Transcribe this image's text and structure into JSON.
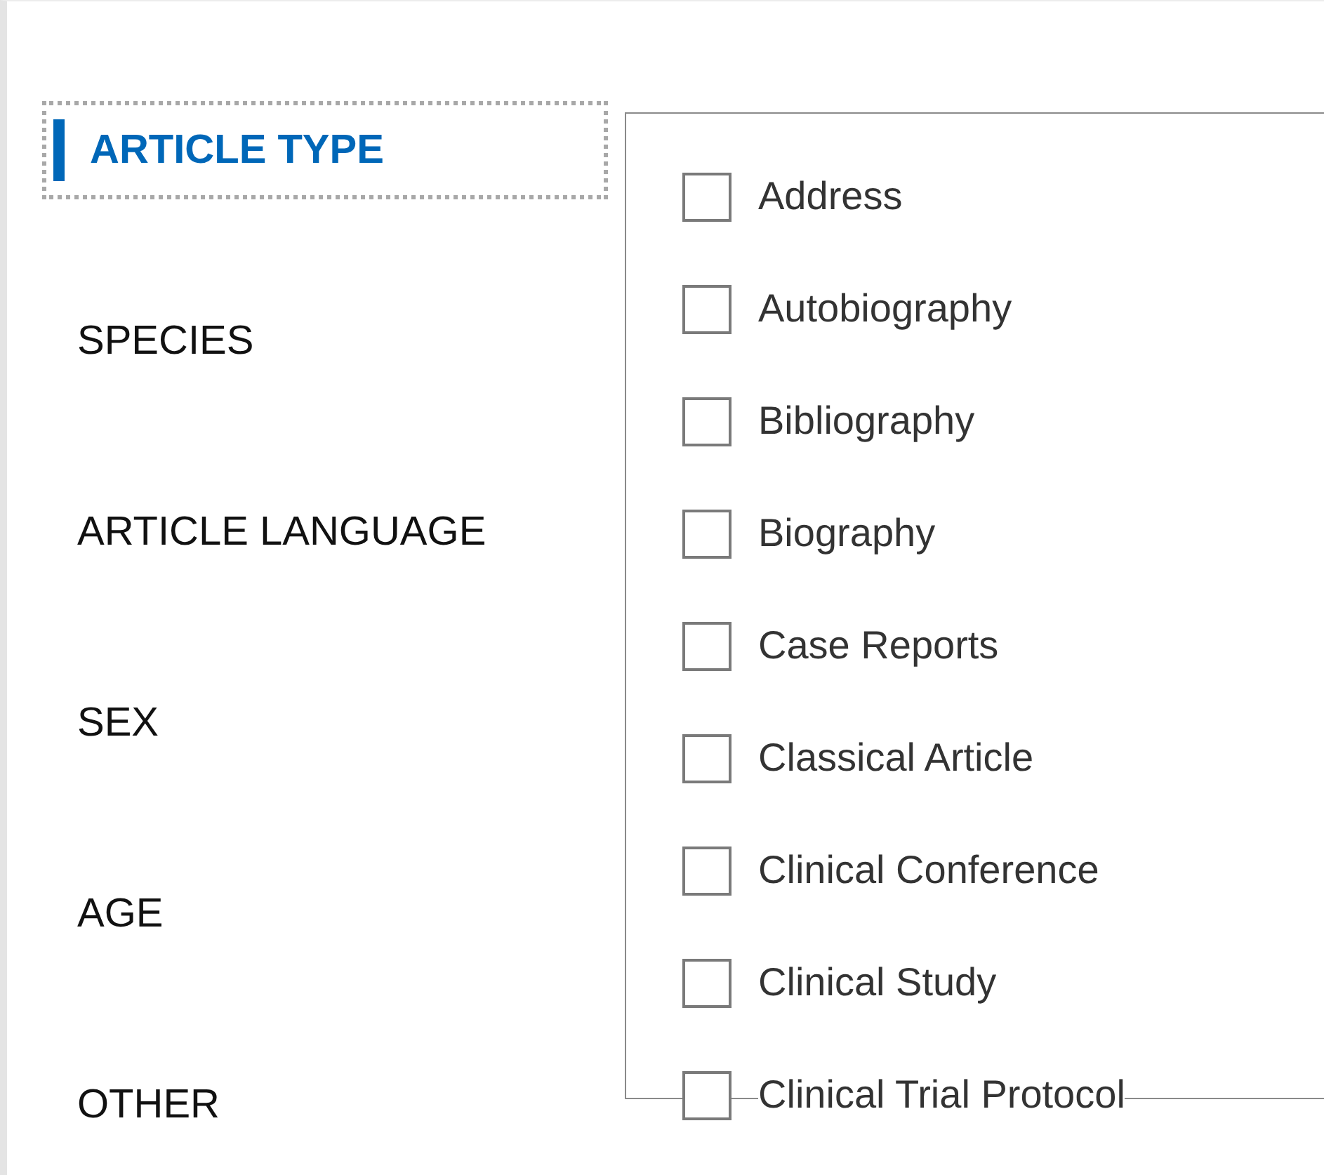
{
  "filter_nav": {
    "items": [
      {
        "label": "ARTICLE TYPE",
        "selected": true
      },
      {
        "label": "SPECIES",
        "selected": false
      },
      {
        "label": "ARTICLE LANGUAGE",
        "selected": false
      },
      {
        "label": "SEX",
        "selected": false
      },
      {
        "label": "AGE",
        "selected": false
      },
      {
        "label": "OTHER",
        "selected": false
      }
    ]
  },
  "options": [
    {
      "label": "Address",
      "checked": false
    },
    {
      "label": "Autobiography",
      "checked": false
    },
    {
      "label": "Bibliography",
      "checked": false
    },
    {
      "label": "Biography",
      "checked": false
    },
    {
      "label": "Case Reports",
      "checked": false
    },
    {
      "label": "Classical Article",
      "checked": false
    },
    {
      "label": "Clinical Conference",
      "checked": false
    },
    {
      "label": "Clinical Study",
      "checked": false
    },
    {
      "label": "Clinical Trial Protocol",
      "checked": false
    }
  ]
}
